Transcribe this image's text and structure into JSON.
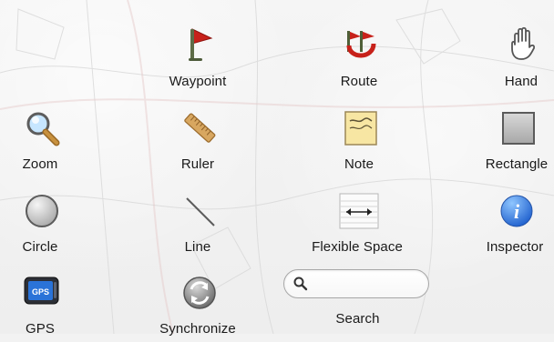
{
  "toolbar": {
    "items": [
      {
        "label": "Waypoint",
        "icon": "waypoint-flag-icon"
      },
      {
        "label": "Route",
        "icon": "route-icon"
      },
      {
        "label": "Hand",
        "icon": "hand-icon"
      },
      {
        "label": "Zoom",
        "icon": "zoom-icon"
      },
      {
        "label": "Ruler",
        "icon": "ruler-icon"
      },
      {
        "label": "Note",
        "icon": "note-icon"
      },
      {
        "label": "Rectangle",
        "icon": "rectangle-icon"
      },
      {
        "label": "Circle",
        "icon": "circle-icon"
      },
      {
        "label": "Line",
        "icon": "line-icon"
      },
      {
        "label": "Flexible Space",
        "icon": "flexible-space-icon"
      },
      {
        "label": "Inspector",
        "icon": "inspector-icon"
      },
      {
        "label": "GPS",
        "icon": "gps-icon"
      },
      {
        "label": "Synchronize",
        "icon": "synchronize-icon"
      },
      {
        "label": "Search",
        "icon": "search-icon"
      }
    ]
  },
  "search": {
    "placeholder": ""
  },
  "colors": {
    "flag_red": "#c7211a",
    "accent_blue": "#2d73d8",
    "text": "#1a1a1a"
  }
}
